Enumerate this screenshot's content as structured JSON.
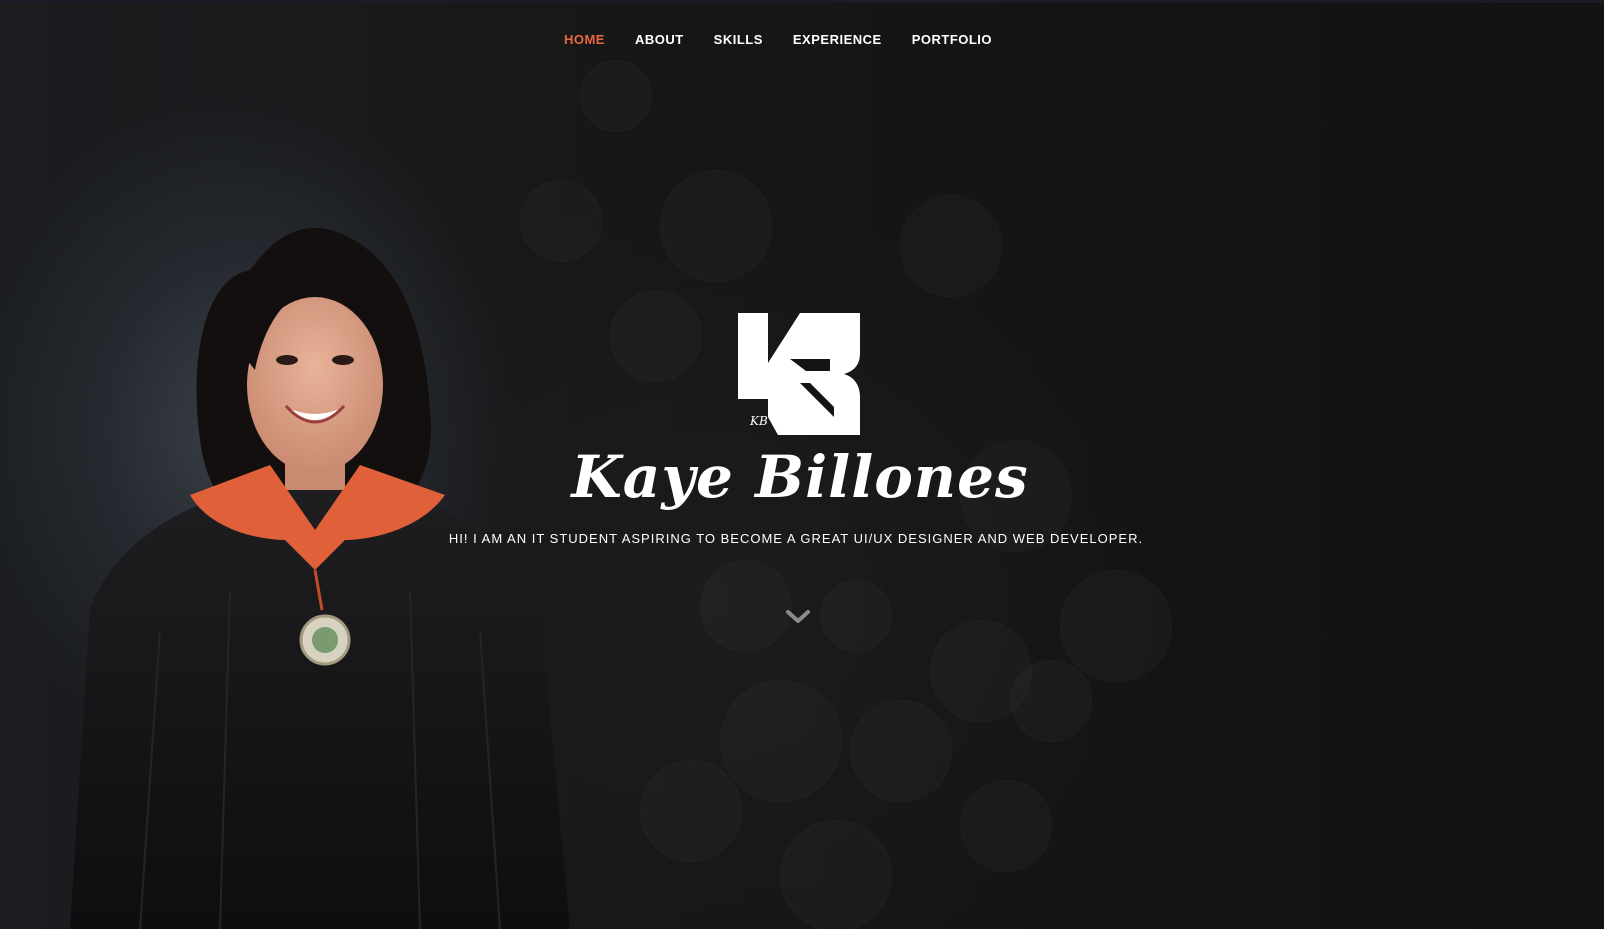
{
  "nav": {
    "items": [
      {
        "label": "HOME",
        "active": true
      },
      {
        "label": "ABOUT",
        "active": false
      },
      {
        "label": "SKILLS",
        "active": false
      },
      {
        "label": "EXPERIENCE",
        "active": false
      },
      {
        "label": "PORTFOLIO",
        "active": false
      }
    ]
  },
  "hero": {
    "logo_letters": "KB",
    "name": "Kaye Billones",
    "tagline": "HI! I AM AN IT STUDENT ASPIRING TO BECOME A GREAT UI/UX DESIGNER AND WEB DEVELOPER.",
    "scroll_icon": "chevron-down-icon"
  },
  "colors": {
    "accent": "#e8683f",
    "text": "#ffffff",
    "background": "#141414"
  }
}
